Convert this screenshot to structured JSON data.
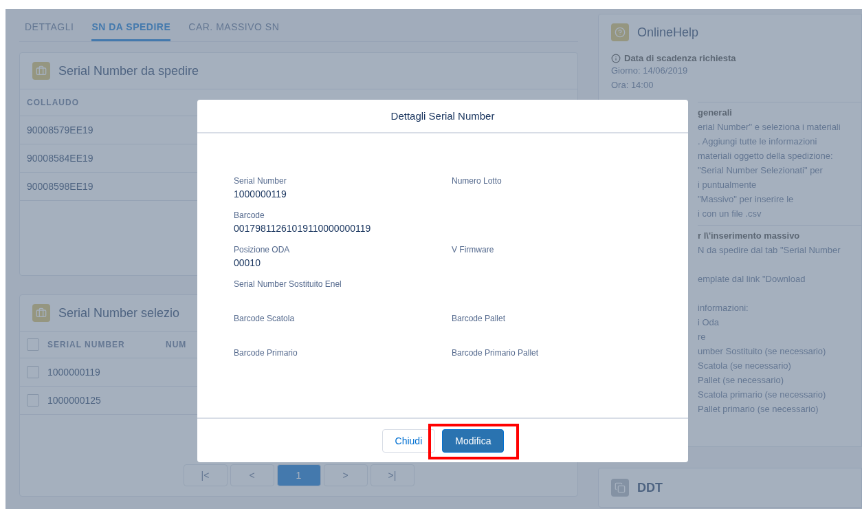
{
  "tabs": [
    {
      "label": "DETTAGLI",
      "selected": false
    },
    {
      "label": "SN DA SPEDIRE",
      "selected": true
    },
    {
      "label": "CAR. MASSIVO SN",
      "selected": false
    }
  ],
  "shipping_card": {
    "title": "Serial Number da spedire",
    "columns": [
      "COLLAUDO"
    ],
    "rows": [
      [
        "90008579EE19"
      ],
      [
        "90008584EE19"
      ],
      [
        "90008598EE19"
      ]
    ]
  },
  "selected_card": {
    "title": "Serial Number selezio",
    "header_checkbox": {
      "checked": false
    },
    "columns": [
      "SERIAL NUMBER",
      "NUM"
    ],
    "rows": [
      {
        "checked": false,
        "cells": [
          "1000000119"
        ]
      },
      {
        "checked": false,
        "cells": [
          "1000000125"
        ]
      }
    ],
    "pagination": [
      {
        "label": "|<",
        "selected": false
      },
      {
        "label": "<",
        "selected": false
      },
      {
        "label": "1",
        "selected": true
      },
      {
        "label": ">",
        "selected": false
      },
      {
        "label": ">|",
        "selected": false
      }
    ]
  },
  "help_card": {
    "title": "OnlineHelp",
    "deadline_title": "Data di scadenza richiesta",
    "deadline_lines": [
      "Giorno: 14/06/2019",
      "Ora: 14:00"
    ],
    "sections": [
      {
        "title": "generali",
        "paragraphs": [
          [
            "erial Number\" e seleziona i materiali",
            ". Aggiungi tutte le informazioni",
            "materiali oggetto della spedizione:"
          ],
          [
            "\"Serial Number Selezionati\" per",
            "i puntualmente"
          ],
          [
            "\"Massivo\" per inserire le",
            "i con un file .csv"
          ]
        ]
      },
      {
        "title": "r l\\'inserimento massivo",
        "paragraphs": [
          [
            "N da spedire dal tab \"Serial Number"
          ],
          [
            "emplate dal link \"Download"
          ],
          [
            "informazioni:",
            "i Oda",
            "re",
            "umber Sostituito (se necessario)",
            "Scatola (se necessario)",
            "Pallet (se necessario)",
            "Scatola primario (se necessario)",
            "Pallet primario (se necessario)"
          ]
        ]
      }
    ]
  },
  "ddt_card": {
    "title": "DDT"
  },
  "modal": {
    "title": "Dettagli Serial Number",
    "fields": [
      [
        {
          "label": "Serial Number",
          "value": "1000000119"
        },
        {
          "label": "Numero Lotto"
        }
      ],
      [
        {
          "label": "Barcode",
          "value": "00179811261019110000000119"
        }
      ],
      [
        {
          "label": "Posizione ODA",
          "value": "00010"
        },
        {
          "label": "V Firmware"
        }
      ],
      [
        {
          "label": "Serial Number Sostituito Enel"
        }
      ],
      [
        {
          "label": "Barcode Scatola"
        },
        {
          "label": "Barcode Pallet"
        }
      ],
      [
        {
          "label": "Barcode Primario"
        },
        {
          "label": "Barcode Primario Pallet"
        }
      ]
    ],
    "buttons": [
      {
        "label": "Chiudi",
        "kind": "neutral",
        "highlighted": false
      },
      {
        "label": "Modifica",
        "kind": "brand",
        "highlighted": true
      }
    ]
  }
}
